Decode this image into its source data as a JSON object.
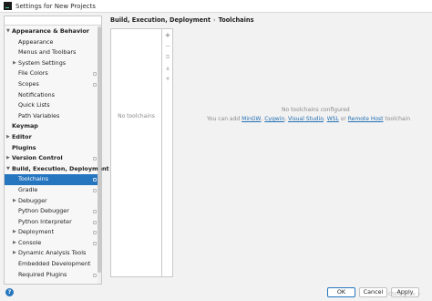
{
  "window": {
    "title": "Settings for New Projects"
  },
  "sidebar": {
    "items": [
      {
        "label": "Appearance & Behavior",
        "level": 0,
        "expandable": true,
        "expanded": true,
        "bold": true,
        "copy_icon": false
      },
      {
        "label": "Appearance",
        "level": 1,
        "expandable": false,
        "bold": false,
        "copy_icon": false
      },
      {
        "label": "Menus and Toolbars",
        "level": 1,
        "expandable": false,
        "bold": false,
        "copy_icon": false
      },
      {
        "label": "System Settings",
        "level": 1,
        "expandable": true,
        "expanded": false,
        "bold": false,
        "copy_icon": false
      },
      {
        "label": "File Colors",
        "level": 1,
        "expandable": false,
        "bold": false,
        "copy_icon": true
      },
      {
        "label": "Scopes",
        "level": 1,
        "expandable": false,
        "bold": false,
        "copy_icon": true
      },
      {
        "label": "Notifications",
        "level": 1,
        "expandable": false,
        "bold": false,
        "copy_icon": false
      },
      {
        "label": "Quick Lists",
        "level": 1,
        "expandable": false,
        "bold": false,
        "copy_icon": false
      },
      {
        "label": "Path Variables",
        "level": 1,
        "expandable": false,
        "bold": false,
        "copy_icon": false
      },
      {
        "label": "Keymap",
        "level": 0,
        "expandable": false,
        "bold": true,
        "copy_icon": false
      },
      {
        "label": "Editor",
        "level": 0,
        "expandable": true,
        "expanded": false,
        "bold": true,
        "copy_icon": false
      },
      {
        "label": "Plugins",
        "level": 0,
        "expandable": false,
        "bold": true,
        "copy_icon": false
      },
      {
        "label": "Version Control",
        "level": 0,
        "expandable": true,
        "expanded": false,
        "bold": true,
        "copy_icon": true
      },
      {
        "label": "Build, Execution, Deployment",
        "level": 0,
        "expandable": true,
        "expanded": true,
        "bold": true,
        "copy_icon": false
      },
      {
        "label": "Toolchains",
        "level": 1,
        "expandable": false,
        "bold": false,
        "selected": true,
        "copy_icon": true
      },
      {
        "label": "Gradle",
        "level": 1,
        "expandable": false,
        "bold": false,
        "copy_icon": true
      },
      {
        "label": "Debugger",
        "level": 1,
        "expandable": true,
        "expanded": false,
        "bold": false,
        "copy_icon": false
      },
      {
        "label": "Python Debugger",
        "level": 1,
        "expandable": false,
        "bold": false,
        "copy_icon": true
      },
      {
        "label": "Python Interpreter",
        "level": 1,
        "expandable": false,
        "bold": false,
        "copy_icon": true
      },
      {
        "label": "Deployment",
        "level": 1,
        "expandable": true,
        "expanded": false,
        "bold": false,
        "copy_icon": true
      },
      {
        "label": "Console",
        "level": 1,
        "expandable": true,
        "expanded": false,
        "bold": false,
        "copy_icon": true
      },
      {
        "label": "Dynamic Analysis Tools",
        "level": 1,
        "expandable": true,
        "expanded": false,
        "bold": false,
        "copy_icon": false
      },
      {
        "label": "Embedded Development",
        "level": 1,
        "expandable": false,
        "bold": false,
        "copy_icon": false
      },
      {
        "label": "Required Plugins",
        "level": 1,
        "expandable": false,
        "bold": false,
        "copy_icon": true
      }
    ]
  },
  "breadcrumb": {
    "parent": "Build, Execution, Deployment",
    "separator": "›",
    "current": "Toolchains"
  },
  "toolchains": {
    "list_empty_text": "No toolchains",
    "detail_empty_title": "No toolchains configured",
    "detail_prefix": "You can add ",
    "links": [
      "MinGW",
      "Cygwin",
      "Visual Studio",
      "WSL",
      "Remote Host"
    ],
    "separators": [
      ", ",
      ", ",
      ", ",
      " or "
    ],
    "detail_suffix": " toolchain",
    "toolbar": {
      "add_icon": "+",
      "remove_icon": "−",
      "copy_icon": "⧉",
      "up_icon": "▲",
      "down_icon": "▼"
    }
  },
  "buttons": {
    "help": "?",
    "ok": "OK",
    "cancel": "Cancel",
    "apply": "Apply"
  },
  "watermark": "CSDN @lolo_z",
  "colors": {
    "selection": "#2675bf",
    "link": "#2470b3"
  }
}
